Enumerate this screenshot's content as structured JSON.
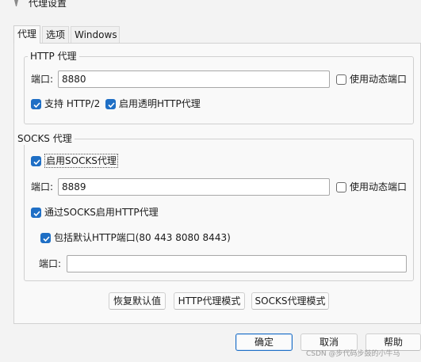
{
  "window": {
    "title": "代理设置"
  },
  "tabs": [
    {
      "label": "代理",
      "active": true
    },
    {
      "label": "选项",
      "active": false
    },
    {
      "label": "Windows",
      "active": false
    }
  ],
  "http_group": {
    "title": "HTTP 代理",
    "port_label": "端口:",
    "port_value": "8880",
    "dynamic_port_label": "使用动态端口",
    "dynamic_port_checked": false,
    "http2_label": "支持 HTTP/2",
    "http2_checked": true,
    "transparent_label": "启用透明HTTP代理",
    "transparent_checked": true
  },
  "socks_group": {
    "title": "SOCKS 代理",
    "enable_label": "启用SOCKS代理",
    "enable_checked": true,
    "port_label": "端口:",
    "port_value": "8889",
    "dynamic_port_label": "使用动态端口",
    "dynamic_port_checked": false,
    "via_http_label": "通过SOCKS启用HTTP代理",
    "via_http_checked": true,
    "default_ports_label": "包括默认HTTP端口(80 443 8080 8443)",
    "default_ports_checked": true,
    "extra_port_label": "端口:",
    "extra_port_value": ""
  },
  "mode_buttons": {
    "restore_defaults": "恢复默认值",
    "http_mode": "HTTP代理模式",
    "socks_mode": "SOCKS代理模式"
  },
  "footer": {
    "ok": "确定",
    "cancel": "取消",
    "help": "帮助"
  },
  "watermark": "CSDN @步代码步鼓的小牛马",
  "colors": {
    "accent": "#1f6fc5",
    "panel": "#f9f9f9",
    "window": "#f3f3f3"
  }
}
